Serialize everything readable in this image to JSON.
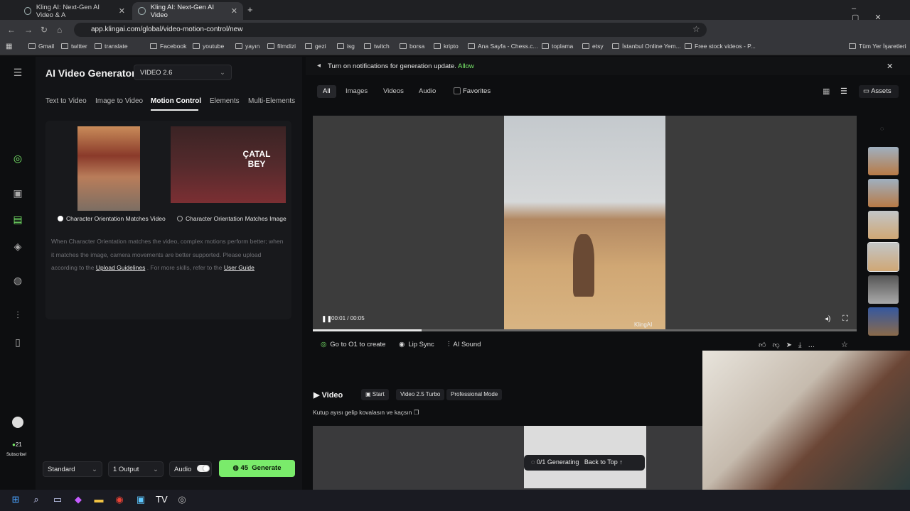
{
  "browser": {
    "tabs": [
      {
        "title": "Kling AI: Next-Gen AI Video & A"
      },
      {
        "title": "Kling AI: Next-Gen AI Video"
      }
    ],
    "url": "app.klingai.com/global/video-motion-control/new",
    "bookmarks": [
      "Gmail",
      "twitter",
      "translate",
      "Facebook",
      "youtube",
      "yayın",
      "filmdizi",
      "gezi",
      "isg",
      "twitch",
      "borsa",
      "kripto",
      "Ana Sayfa - Chess.c...",
      "toplama",
      "etsy",
      "İstanbul Online Yem...",
      "Free stock videos - P...",
      "Tüm Yer İşaretleri"
    ]
  },
  "left": {
    "title": "AI Video Generator",
    "model": "VIDEO 2.6",
    "tabs": [
      "Text to Video",
      "Image to Video",
      "Motion Control",
      "Elements",
      "Multi-Elements"
    ],
    "imageB_text": "ÇATAL BEY",
    "option_video": "Character Orientation Matches Video",
    "option_image": "Character Orientation Matches Image",
    "desc1": "When Character Orientation matches the video, complex motions perform better; when it matches the image, camera movements are better supported. Please upload according to the",
    "link_upload": "Upload Guidelines",
    "desc2": ". For more skills, refer to the",
    "link_guide": "User Guide",
    "credits": "21",
    "subscribe": "Subscribe!",
    "mode": "Standard",
    "outputs": "1 Output",
    "audio": "Audio",
    "generate_cost": "45",
    "generate": "Generate"
  },
  "right": {
    "notification": "Turn on notifications for generation update.",
    "allow": "Allow",
    "filters": [
      "All",
      "Images",
      "Videos",
      "Audio"
    ],
    "favorites": "Favorites",
    "assets": "Assets",
    "time": "00:01 / 00:05",
    "progress": 0.2,
    "watermark": "KlingAI",
    "actions": [
      "Go to O1 to create",
      "Lip Sync",
      "AI Sound"
    ],
    "video_heading": "Video",
    "chips": [
      "Start",
      "Video 2.5 Turbo",
      "Professional Mode"
    ],
    "prompt": "Kutup ayısı gelip kovalasın ve kaçsın",
    "generating": "0/1 Generating",
    "back_to_top": "Back to Top"
  }
}
